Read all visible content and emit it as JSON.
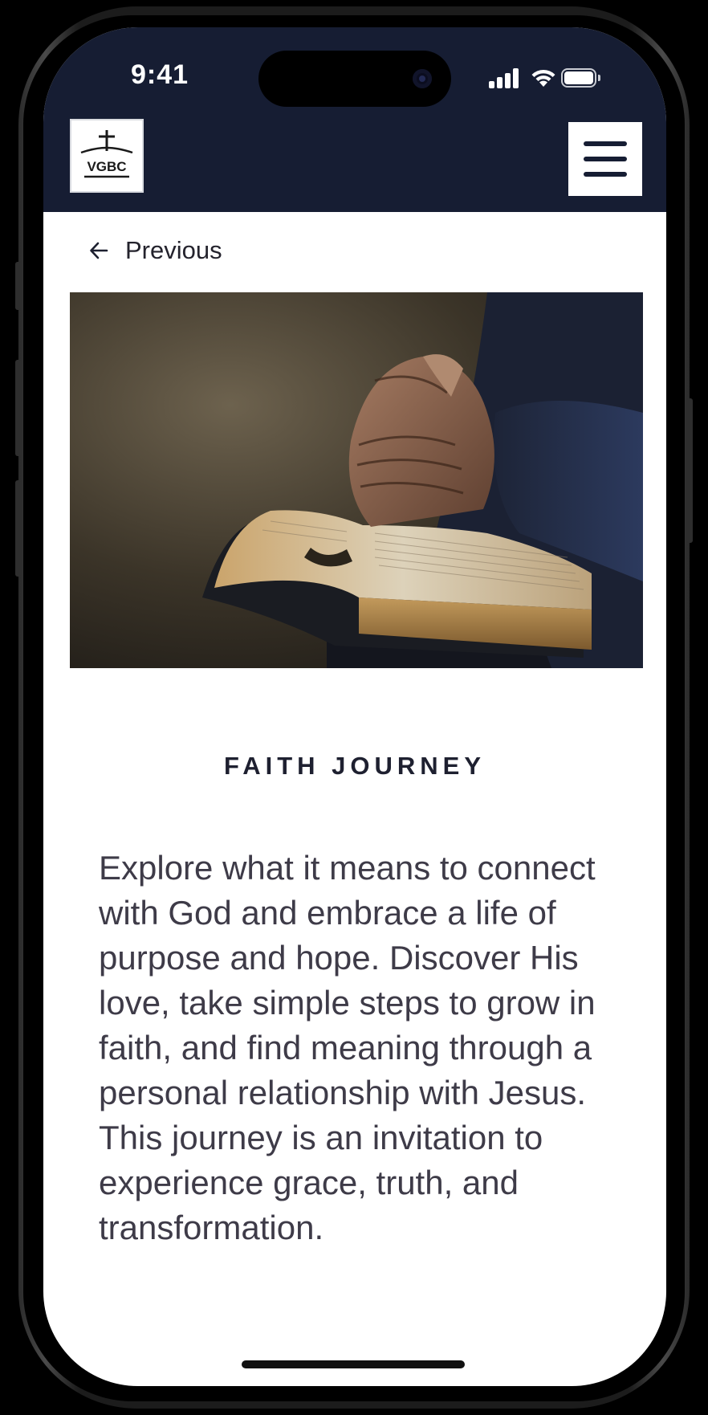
{
  "status_bar": {
    "time": "9:41"
  },
  "header": {
    "logo_text": "VGBC",
    "menu_icon": "hamburger-menu-icon",
    "background_color": "#161d33"
  },
  "nav": {
    "previous_label": "Previous",
    "previous_icon": "arrow-left-icon"
  },
  "hero": {
    "image": "praying-hands-on-open-bible-photo"
  },
  "content": {
    "eyebrow": "FAITH JOURNEY",
    "body": "Explore what it means to connect with God and embrace a life of purpose and hope. Discover His love, take simple steps to grow in faith, and find meaning through a personal relationship with Jesus. This journey is an invitation to experience grace, truth, and transformation."
  },
  "colors": {
    "accent_dark": "#161d33",
    "text_primary": "#1e2030",
    "text_body": "#3e3b48"
  }
}
